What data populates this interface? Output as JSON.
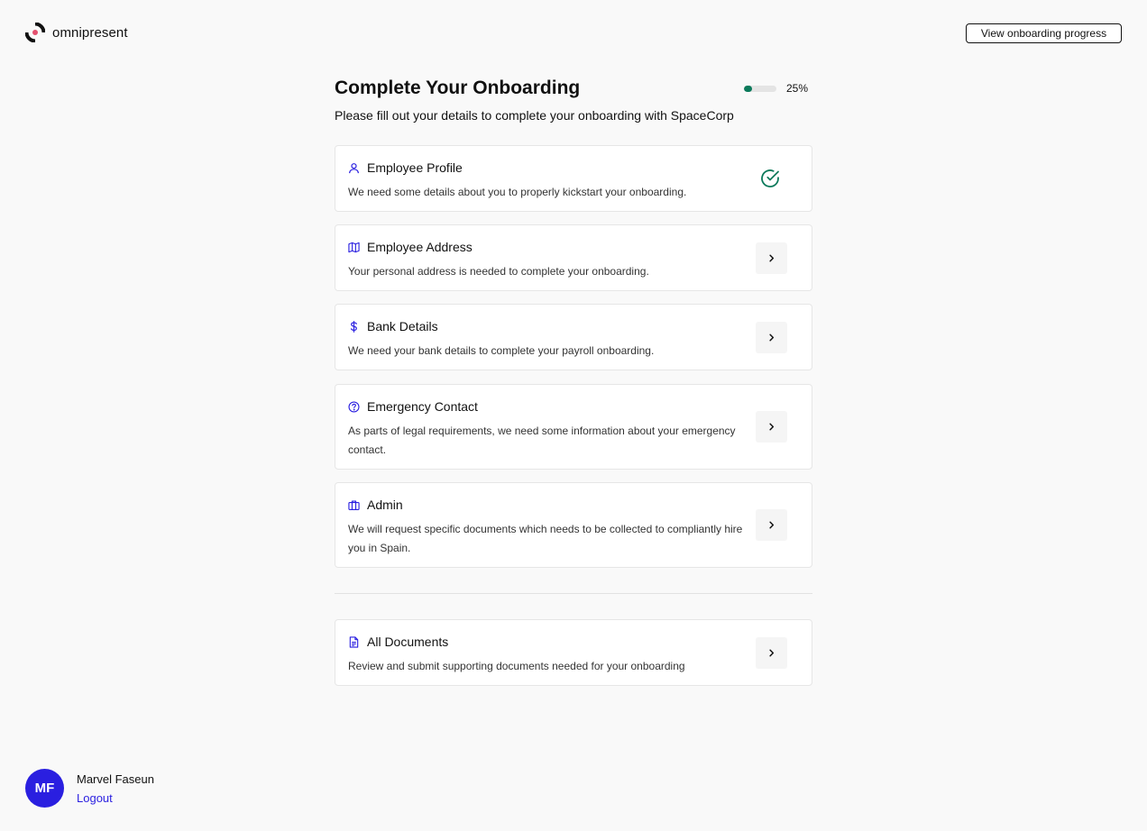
{
  "brand": {
    "name": "omnipresent"
  },
  "header": {
    "progress_button_label": "View onboarding progress"
  },
  "onboarding": {
    "title": "Complete Your Onboarding",
    "subtitle": "Please fill out your details to complete your onboarding with SpaceCorp",
    "progress": {
      "value": 0.25,
      "label": "25%"
    },
    "steps": [
      {
        "title": "Employee Profile",
        "description": "We need some details about you to properly kickstart your onboarding.",
        "icon": "user-icon",
        "status": "completed"
      },
      {
        "title": "Employee Address",
        "description": "Your personal address is needed to complete your onboarding.",
        "icon": "map-icon",
        "status": "pending"
      },
      {
        "title": "Bank Details",
        "description": "We need your bank details to complete your payroll onboarding.",
        "icon": "dollar-icon",
        "status": "pending"
      },
      {
        "title": "Emergency Contact",
        "description": "As parts of legal requirements, we need some information about your emergency contact.",
        "icon": "question-circle-icon",
        "status": "pending"
      },
      {
        "title": "Admin",
        "description": "We will request specific documents which needs to be collected to compliantly hire you in Spain.",
        "icon": "briefcase-icon",
        "status": "pending"
      }
    ],
    "documents": {
      "title": "All Documents",
      "description": "Review and submit supporting documents needed for your onboarding",
      "icon": "document-icon"
    }
  },
  "user": {
    "initials": "MF",
    "name": "Marvel Faseun",
    "logout_label": "Logout"
  },
  "colors": {
    "accent": "#2a1fe0",
    "success": "#0b7a5b"
  }
}
